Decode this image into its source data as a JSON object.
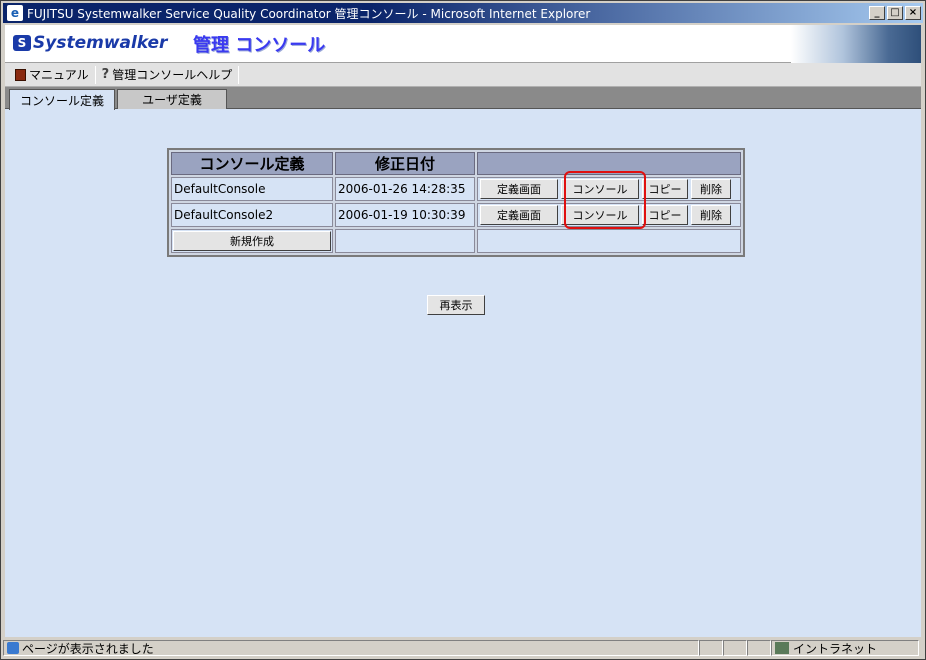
{
  "window": {
    "title": "FUJITSU Systemwalker Service Quality Coordinator 管理コンソール - Microsoft Internet Explorer",
    "min_label": "_",
    "max_label": "□",
    "close_label": "×"
  },
  "header": {
    "logo_text": "Systemwalker",
    "title": "管理 コンソール"
  },
  "menubar": {
    "items": [
      {
        "label": "マニュアル",
        "icon": "book-icon"
      },
      {
        "label": "管理コンソールヘルプ",
        "icon": "help-icon"
      }
    ]
  },
  "tabs": [
    {
      "label": "コンソール定義",
      "active": true
    },
    {
      "label": "ユーザ定義",
      "active": false
    }
  ],
  "table": {
    "headers": [
      "コンソール定義",
      "修正日付",
      ""
    ],
    "rows": [
      {
        "name": "DefaultConsole",
        "date": "2006-01-26 14:28:35"
      },
      {
        "name": "DefaultConsole2",
        "date": "2006-01-19 10:30:39"
      }
    ],
    "row_actions": {
      "define": "定義画面",
      "console": "コンソール",
      "copy": "コピー",
      "delete": "削除"
    },
    "new_button": "新規作成"
  },
  "refresh_button": "再表示",
  "statusbar": {
    "message": "ページが表示されました",
    "zone": "イントラネット"
  },
  "colors": {
    "highlight": "#e01010",
    "content_bg": "#d6e3f5"
  }
}
